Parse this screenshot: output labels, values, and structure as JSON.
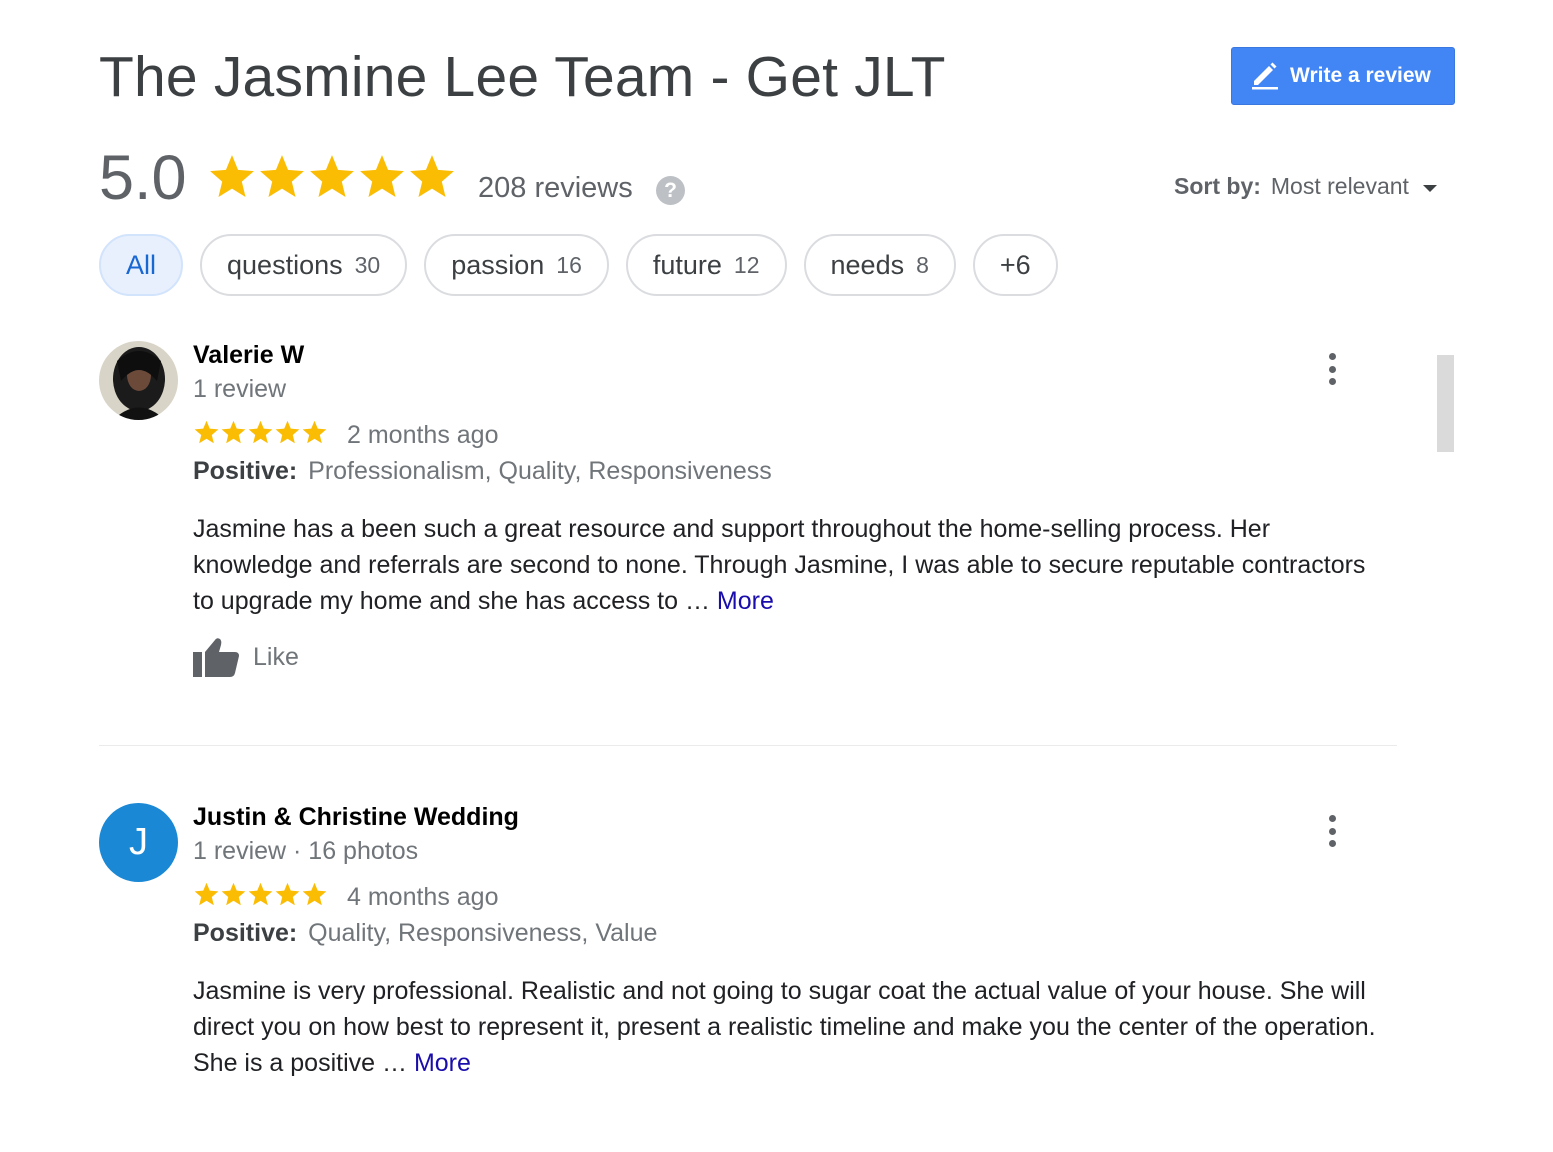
{
  "header": {
    "title": "The Jasmine Lee Team - Get JLT",
    "write_review_label": "Write a review"
  },
  "summary": {
    "rating": "5.0",
    "stars": 5,
    "review_count": "208 reviews",
    "help_glyph": "?",
    "star_color": "#fbbc04"
  },
  "sort": {
    "label": "Sort by:",
    "value": "Most relevant"
  },
  "chips": [
    {
      "label": "All",
      "count": "",
      "active": true
    },
    {
      "label": "questions",
      "count": "30"
    },
    {
      "label": "passion",
      "count": "16"
    },
    {
      "label": "future",
      "count": "12"
    },
    {
      "label": "needs",
      "count": "8"
    },
    {
      "label": "+6",
      "count": ""
    }
  ],
  "reviews": [
    {
      "name": "Valerie W",
      "meta": "1 review",
      "stars": 5,
      "time": "2 months ago",
      "positive_label": "Positive:",
      "positive": "Professionalism, Quality, Responsiveness",
      "text": "Jasmine has a been such a great resource and support throughout the home-selling process.  Her knowledge and referrals are second to none.  Through Jasmine, I was able to secure reputable contractors to upgrade my home and she has access to … ",
      "more": "More",
      "like_label": "Like",
      "avatar": "photo"
    },
    {
      "name": "Justin & Christine Wedding",
      "meta": "1 review · 16 photos",
      "stars": 5,
      "time": "4 months ago",
      "positive_label": "Positive:",
      "positive": "Quality, Responsiveness, Value",
      "text": "Jasmine is very professional. Realistic and not going to sugar coat the actual value of your house. She will direct you on how best to represent it, present a realistic timeline and make you the center of the operation. She is a positive … ",
      "more": "More",
      "avatar_letter": "J",
      "avatar_color": "#1a88d4"
    }
  ]
}
